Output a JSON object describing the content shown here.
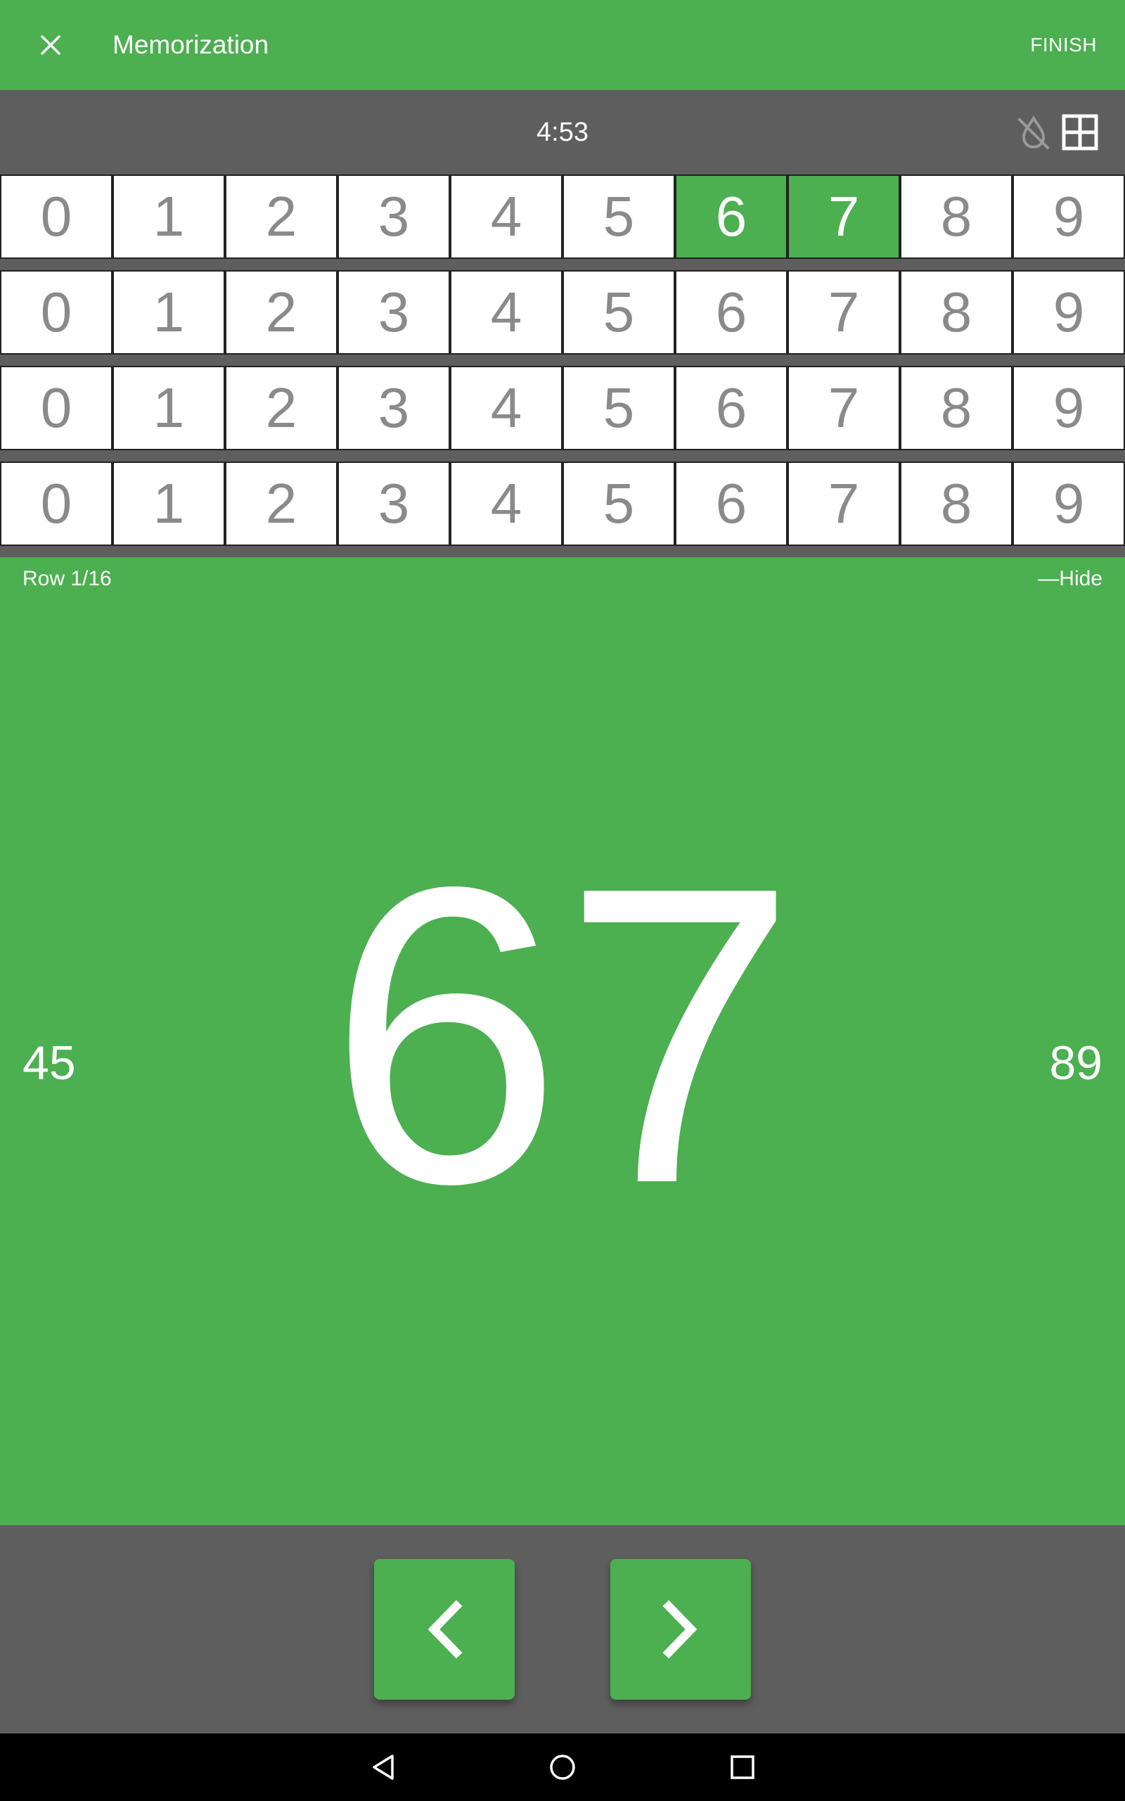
{
  "appbar": {
    "title": "Memorization",
    "finish_label": "FINISH",
    "close_icon": "close-icon"
  },
  "timer": {
    "value": "4:53",
    "icons": [
      "hint-off-icon",
      "grid-icon"
    ]
  },
  "digit_rows": [
    {
      "digits": [
        "0",
        "1",
        "2",
        "3",
        "4",
        "5",
        "6",
        "7",
        "8",
        "9"
      ],
      "active": [
        6,
        7
      ]
    },
    {
      "digits": [
        "0",
        "1",
        "2",
        "3",
        "4",
        "5",
        "6",
        "7",
        "8",
        "9"
      ],
      "active": []
    },
    {
      "digits": [
        "0",
        "1",
        "2",
        "3",
        "4",
        "5",
        "6",
        "7",
        "8",
        "9"
      ],
      "active": []
    },
    {
      "digits": [
        "0",
        "1",
        "2",
        "3",
        "4",
        "5",
        "6",
        "7",
        "8",
        "9"
      ],
      "active": []
    }
  ],
  "main": {
    "row_label": "Row 1/16",
    "hide_label": "—Hide",
    "current": "67",
    "previous": "45",
    "next": "89"
  },
  "navigation": {
    "prev_icon": "chevron-left-icon",
    "next_icon": "chevron-right-icon"
  },
  "system_nav": [
    "back-icon",
    "home-icon",
    "recents-icon"
  ],
  "colors": {
    "accent": "#4caf50",
    "toolbar_gray": "#5e5e5e",
    "digit_text": "#8a8a8a"
  }
}
